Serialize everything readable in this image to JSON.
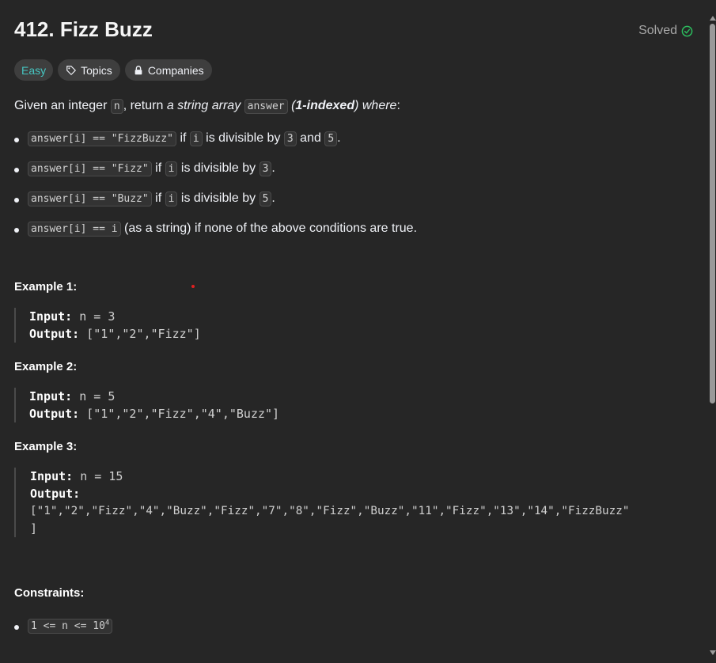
{
  "problem": {
    "title": "412. Fizz Buzz",
    "status": "Solved",
    "status_color": "#2cbb5d"
  },
  "tags": {
    "difficulty": "Easy",
    "difficulty_color": "#46c6c2",
    "topics": "Topics",
    "companies": "Companies"
  },
  "description": {
    "p1": "Given an integer ",
    "var_n": "n",
    "p2": ", return ",
    "p3": "a string array",
    "var_answer": "answer",
    "p4_open": " (",
    "p4_bold": "1-indexed",
    "p4_close": ")",
    "p5": " where",
    "p6": ":"
  },
  "rules": [
    {
      "code": "answer[i] == \"FizzBuzz\"",
      "t1": " if ",
      "c1": "i",
      "t2": " is divisible by ",
      "c2": "3",
      "t3": " and ",
      "c3": "5",
      "t4": "."
    },
    {
      "code": "answer[i] == \"Fizz\"",
      "t1": " if ",
      "c1": "i",
      "t2": " is divisible by ",
      "c2": "3",
      "t3": "."
    },
    {
      "code": "answer[i] == \"Buzz\"",
      "t1": " if ",
      "c1": "i",
      "t2": " is divisible by ",
      "c2": "5",
      "t3": "."
    },
    {
      "code": "answer[i] == i",
      "t1": " (as a string) if none of the above conditions are true."
    }
  ],
  "examples": [
    {
      "title": "Example 1:",
      "input_label": "Input:",
      "input": " n = 3",
      "output_label": "Output:",
      "output": " [\"1\",\"2\",\"Fizz\"]"
    },
    {
      "title": "Example 2:",
      "input_label": "Input:",
      "input": " n = 5",
      "output_label": "Output:",
      "output": " [\"1\",\"2\",\"Fizz\",\"4\",\"Buzz\"]"
    },
    {
      "title": "Example 3:",
      "input_label": "Input:",
      "input": " n = 15",
      "output_label": "Output:",
      "output_line1": "[\"1\",\"2\",\"Fizz\",\"4\",\"Buzz\",\"Fizz\",\"7\",\"8\",\"Fizz\",\"Buzz\",\"11\",\"Fizz\",\"13\",\"14\",\"FizzBuzz\"",
      "output_line2": "]"
    }
  ],
  "constraints": {
    "title": "Constraints:",
    "item_base": "1 <= n <= 10",
    "item_exp": "4"
  }
}
